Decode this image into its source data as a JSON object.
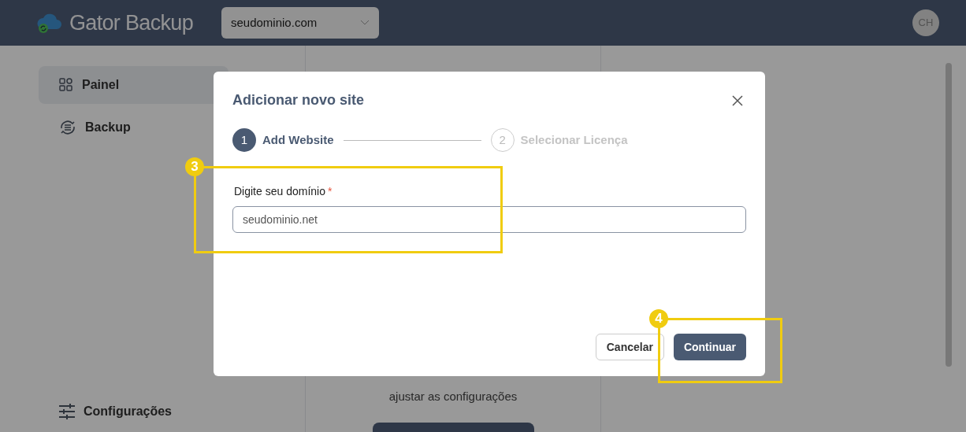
{
  "header": {
    "app_name": "Gator Backup",
    "domain_select": {
      "value": "seudominio.com"
    },
    "avatar": "CH"
  },
  "sidebar": {
    "items": [
      {
        "label": "Painel",
        "selected": true
      },
      {
        "label": "Backup",
        "selected": false
      }
    ],
    "footer_item": {
      "label": "Configurações"
    }
  },
  "main": {
    "message_lines": [
      "ajustar as configurações"
    ]
  },
  "modal": {
    "title": "Adicionar novo site",
    "steps": [
      {
        "number": "1",
        "label": "Add Website",
        "selected": true
      },
      {
        "number": "2",
        "label": "Selecionar Licença",
        "selected": false
      }
    ],
    "field": {
      "label": "Digite seu domínio",
      "required_mark": "*",
      "value": "seudominio.net"
    },
    "buttons": [
      {
        "label": "Cancelar",
        "kind": "secondary"
      },
      {
        "label": "Continuar",
        "kind": "primary"
      }
    ]
  },
  "annotations": [
    {
      "number": "3"
    },
    {
      "number": "4"
    }
  ]
}
